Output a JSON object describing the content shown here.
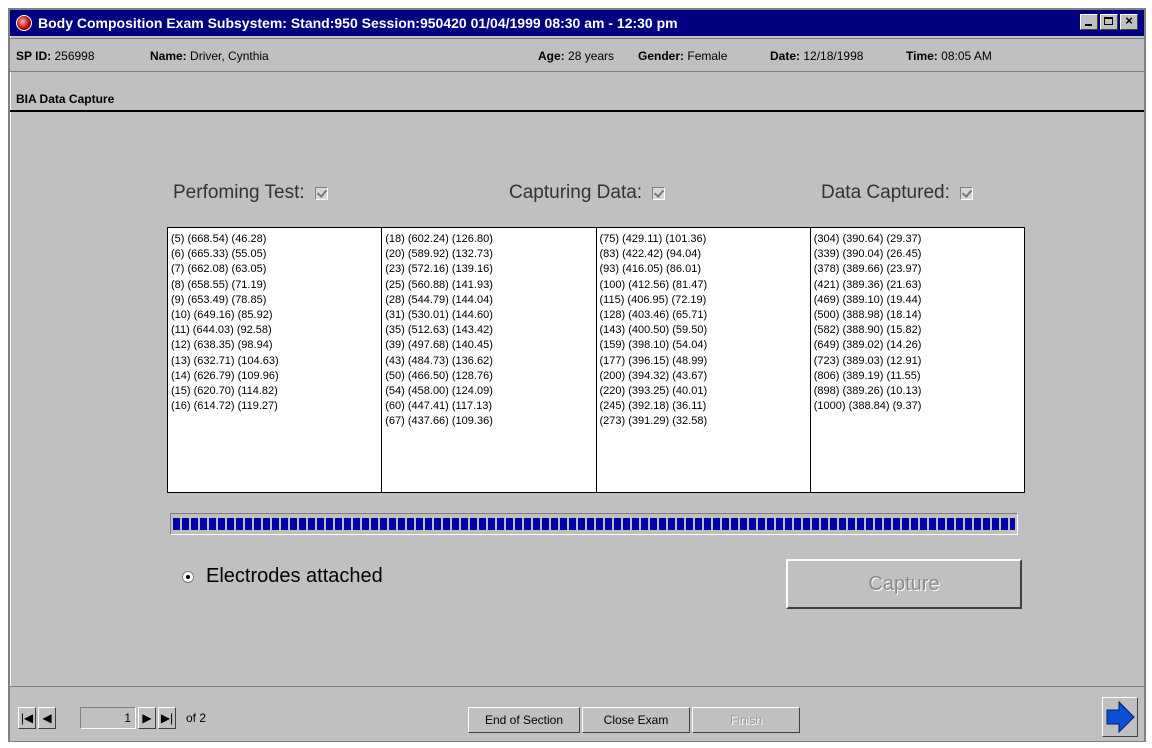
{
  "window": {
    "title": "Body Composition Exam Subsystem: Stand:950 Session:950420 01/04/1999 08:30 am - 12:30 pm"
  },
  "participant": {
    "sp_id_label": "SP ID:",
    "sp_id": "256998",
    "name_label": "Name:",
    "name": "Driver, Cynthia",
    "age_label": "Age:",
    "age": "28 years",
    "gender_label": "Gender:",
    "gender": "Female",
    "date_label": "Date:",
    "date": "12/18/1998",
    "time_label": "Time:",
    "time": "08:05 AM"
  },
  "section": {
    "title": "BIA Data Capture"
  },
  "status": {
    "performing_test": "Perfoming Test:",
    "capturing_data": "Capturing Data:",
    "data_captured": "Data Captured:"
  },
  "data_columns": [
    [
      "(5) (668.54) (46.28)",
      "(6) (665.33) (55.05)",
      "(7) (662.08) (63.05)",
      "(8) (658.55) (71.19)",
      "(9) (653.49) (78.85)",
      "(10) (649.16) (85.92)",
      "(11) (644.03) (92.58)",
      "(12) (638.35) (98.94)",
      "(13) (632.71) (104.63)",
      "(14) (626.79) (109.96)",
      "(15) (620.70) (114.82)",
      "(16) (614.72) (119.27)"
    ],
    [
      "(18) (602.24) (126.80)",
      "(20) (589.92) (132.73)",
      "(23) (572.16) (139.16)",
      "(25) (560.88) (141.93)",
      "(28) (544.79) (144.04)",
      "(31) (530.01) (144.60)",
      "(35) (512.63) (143.42)",
      "(39) (497.68) (140.45)",
      "(43) (484.73) (136.62)",
      "(50) (466.50) (128.76)",
      "(54) (458.00) (124.09)",
      "(60) (447.41) (117.13)",
      "(67) (437.66) (109.36)"
    ],
    [
      "(75) (429.11) (101.36)",
      "(83) (422.42) (94.04)",
      "(93) (416.05) (86.01)",
      "(100) (412.56) (81.47)",
      "(115) (406.95) (72.19)",
      "(128) (403.46) (65.71)",
      "(143) (400.50) (59.50)",
      "(159) (398.10) (54.04)",
      "(177) (396.15) (48.99)",
      "(200) (394.32) (43.67)",
      "(220) (393.25) (40.01)",
      "(245) (392.18) (36.11)",
      "(273) (391.29) (32.58)"
    ],
    [
      "(304) (390.64) (29.37)",
      "(339) (390.04) (26.45)",
      "(378) (389.66) (23.97)",
      "(421) (389.36) (21.63)",
      "(469) (389.10) (19.44)",
      "(500) (388.98) (18.14)",
      "(582) (388.90) (15.82)",
      "(649) (389.02) (14.26)",
      "(723) (389.03) (12.91)",
      "(806) (389.19) (11.55)",
      "(898) (389.26) (10.13)",
      "(1000) (388.84) (9.37)"
    ]
  ],
  "progress": {
    "fraction": 1.0
  },
  "electrodes": {
    "label": "Electrodes attached"
  },
  "capture_button": {
    "label": "Capture"
  },
  "footer": {
    "page_current": "1",
    "page_of": "of 2",
    "end_of_section": "End of Section",
    "close_exam": "Close Exam",
    "finish": "Finish"
  },
  "colors": {
    "titlebar": "#000080",
    "progress": "#0000a8",
    "face": "#c0c0c0",
    "next_arrow": "#0a4fd8"
  }
}
